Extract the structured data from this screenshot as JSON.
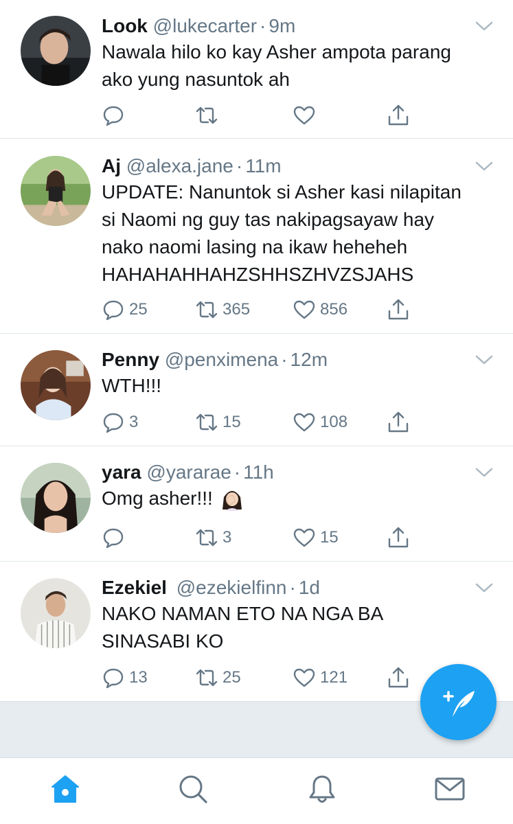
{
  "accent_color": "#1da1f2",
  "muted_color": "#657786",
  "tweets": [
    {
      "name": "Look",
      "handle": "@lukecarter",
      "time": "9m",
      "text": [
        "Nawala hilo ko kay Asher ampota parang",
        "ako yung nasuntok ah"
      ],
      "replies": "",
      "retweets": "",
      "likes": ""
    },
    {
      "name": "Aj",
      "handle": "@alexa.jane",
      "time": "11m",
      "text": [
        "UPDATE: Nanuntok si Asher kasi nilapitan",
        "si Naomi ng guy tas nakipagsayaw hay",
        "nako naomi lasing na ikaw heheheh",
        "HAHAHAHHAHZSHHSZHVZSJAHS"
      ],
      "replies": "25",
      "retweets": "365",
      "likes": "856"
    },
    {
      "name": "Penny",
      "handle": "@penximena",
      "time": "12m",
      "text": [
        "WTH!!!"
      ],
      "replies": "3",
      "retweets": "15",
      "likes": "108"
    },
    {
      "name": "yara",
      "handle": "@yararae",
      "time": "11h",
      "text": [
        "Omg asher!!! "
      ],
      "emoji": "woman-facepalming",
      "replies": "",
      "retweets": "3",
      "likes": "15"
    },
    {
      "name": "Ezekiel",
      "handle": "@ezekielfinn",
      "time": "1d",
      "text": [
        "NAKO NAMAN ETO NA NGA BA",
        "SINASABI KO"
      ],
      "replies": "13",
      "retweets": "25",
      "likes": "121"
    }
  ],
  "tab_bar": [
    "home-icon",
    "search-icon",
    "notifications-icon",
    "messages-icon"
  ],
  "compose_button": "compose-tweet-icon"
}
